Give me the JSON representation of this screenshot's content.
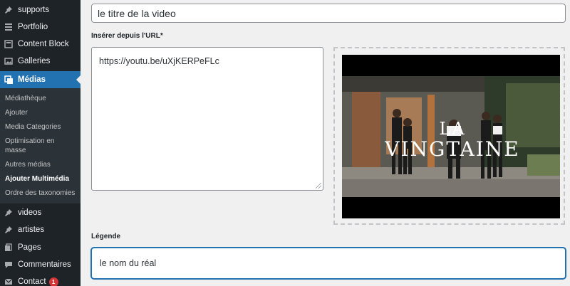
{
  "sidebar": {
    "menu": [
      {
        "key": "supports",
        "label": "supports",
        "icon": "pin-icon"
      },
      {
        "key": "portfolio",
        "label": "Portfolio",
        "icon": "portfolio-icon"
      },
      {
        "key": "content_block",
        "label": "Content Block",
        "icon": "content-block-icon"
      },
      {
        "key": "galleries",
        "label": "Galleries",
        "icon": "gallery-icon"
      },
      {
        "key": "medias",
        "label": "Médias",
        "icon": "media-icon",
        "active": true
      }
    ],
    "submenu": [
      {
        "label": "Médiathèque"
      },
      {
        "label": "Ajouter"
      },
      {
        "label": "Media Categories"
      },
      {
        "label": "Optimisation en masse"
      },
      {
        "label": "Autres médias"
      },
      {
        "label": "Ajouter Multimédia",
        "current": true
      },
      {
        "label": "Ordre des taxonomies"
      }
    ],
    "menu_bottom": [
      {
        "key": "videos",
        "label": "videos",
        "icon": "pin-icon"
      },
      {
        "key": "artistes",
        "label": "artistes",
        "icon": "pin-icon"
      },
      {
        "key": "pages",
        "label": "Pages",
        "icon": "pages-icon"
      },
      {
        "key": "commentaires",
        "label": "Commentaires",
        "icon": "comment-icon"
      },
      {
        "key": "contact",
        "label": "Contact",
        "icon": "mail-icon",
        "badge": "1"
      }
    ]
  },
  "form": {
    "title_value": "le titre de la video",
    "url_label": "Insérer depuis l'URL*",
    "url_value": "https://youtu.be/uXjKERPeFLc",
    "caption_label": "Légende",
    "caption_value": "le nom du réal"
  },
  "preview": {
    "overlay_line1": "LA",
    "overlay_line2": "VINGTAINE"
  },
  "colors": {
    "sidebar_bg": "#1d2327",
    "submenu_bg": "#2c3338",
    "accent": "#2271b1",
    "badge": "#d63638"
  }
}
